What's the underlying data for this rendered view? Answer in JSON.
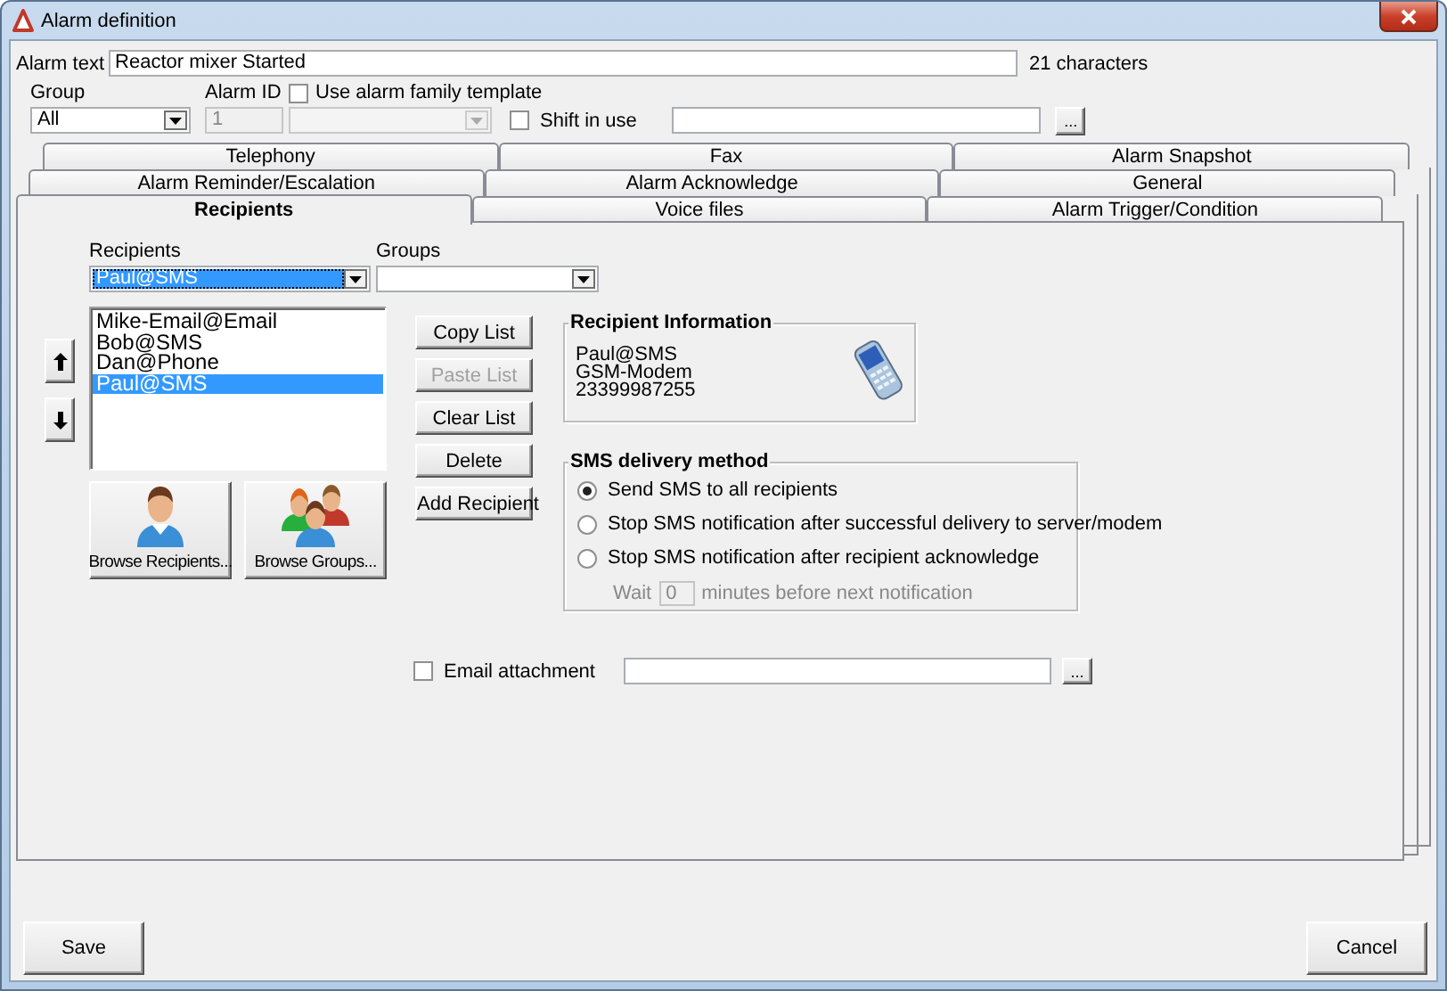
{
  "window": {
    "title": "Alarm definition"
  },
  "alarm_text": {
    "label": "Alarm text",
    "value": "Reactor mixer Started",
    "count": "21 characters"
  },
  "group": {
    "label": "Group",
    "value": "All"
  },
  "alarm_id": {
    "label": "Alarm ID",
    "value": "1",
    "disabled": true
  },
  "family_template": {
    "label": "Use alarm family template",
    "checked": false,
    "disabled": true
  },
  "shift": {
    "label": "Shift in use",
    "checked": false,
    "browse": "..."
  },
  "tab_rows": [
    [
      {
        "label": "Telephony",
        "selected": false
      },
      {
        "label": "Fax",
        "selected": false
      },
      {
        "label": "Alarm Snapshot",
        "selected": false
      }
    ],
    [
      {
        "label": "Alarm Reminder/Escalation",
        "selected": false
      },
      {
        "label": "Alarm Acknowledge",
        "selected": false
      },
      {
        "label": "General",
        "selected": false
      }
    ],
    [
      {
        "label": "Recipients",
        "selected": true
      },
      {
        "label": "Voice files",
        "selected": false
      },
      {
        "label": "Alarm Trigger/Condition",
        "selected": false
      }
    ]
  ],
  "recipients": {
    "label": "Recipients",
    "value": "Paul@SMS",
    "focused": true
  },
  "groups": {
    "label": "Groups"
  },
  "recipient_list": [
    {
      "label": "Mike-Email@Email",
      "selected": false
    },
    {
      "label": "Bob@SMS",
      "selected": false
    },
    {
      "label": "Dan@Phone",
      "selected": false
    },
    {
      "label": "Paul@SMS",
      "selected": true
    }
  ],
  "list_buttons": [
    {
      "label": "Copy List",
      "disabled": false
    },
    {
      "label": "Paste List",
      "disabled": true
    },
    {
      "label": "Clear List",
      "disabled": false
    },
    {
      "label": "Delete",
      "disabled": false
    },
    {
      "label": "Add Recipient",
      "disabled": false
    }
  ],
  "browse_buttons": [
    {
      "label": "Browse Recipients...",
      "kind": "person"
    },
    {
      "label": "Browse Groups...",
      "kind": "group"
    }
  ],
  "recipient_info": {
    "title": "Recipient Information",
    "lines": [
      "Paul@SMS",
      "GSM-Modem",
      "23399987255"
    ]
  },
  "sms_delivery": {
    "title": "SMS delivery method",
    "options": [
      {
        "label": "Send SMS to all recipients",
        "selected": true
      },
      {
        "label": "Stop SMS notification after successful delivery to server/modem",
        "selected": false
      },
      {
        "label": "Stop SMS notification after recipient acknowledge",
        "selected": false
      }
    ],
    "wait": {
      "label": "Wait",
      "value": "0",
      "suffix": "minutes before next notification",
      "disabled": true
    }
  },
  "email_attachment": {
    "label": "Email attachment",
    "checked": false,
    "browse": "..."
  },
  "footer": [
    {
      "label": "Save"
    },
    {
      "label": "Cancel"
    }
  ]
}
